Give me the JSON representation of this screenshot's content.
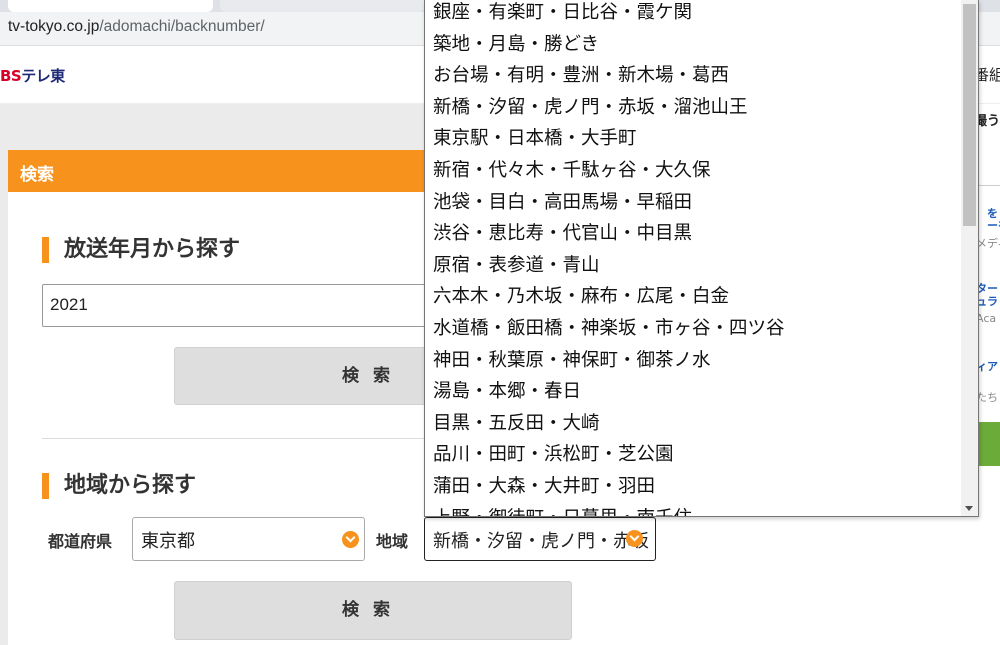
{
  "browser": {
    "url_host": "tv-tokyo.co.jp",
    "url_path": "/adomachi/backnumber/"
  },
  "header": {
    "logo_bs": "BS",
    "logo_tv": "テレ東"
  },
  "search": {
    "panel_title": "検索",
    "year_section_title": "放送年月から探す",
    "year_value": "2021",
    "year_button": "検索",
    "region_section_title": "地域から探す",
    "prefecture_label": "都道府県",
    "prefecture_value": "東京都",
    "area_label": "地域",
    "area_value": "新橋・汐留・虎ノ門・赤坂",
    "region_button": "検索"
  },
  "dropdown": {
    "options": [
      "銀座・有楽町・日比谷・霞ケ関",
      "築地・月島・勝どき",
      "お台場・有明・豊洲・新木場・葛西",
      "新橋・汐留・虎ノ門・赤坂・溜池山王",
      "東京駅・日本橋・大手町",
      "新宿・代々木・千駄ヶ谷・大久保",
      "池袋・目白・高田馬場・早稲田",
      "渋谷・恵比寿・代官山・中目黒",
      "原宿・表参道・青山",
      "六本木・乃木坂・麻布・広尾・白金",
      "水道橋・飯田橋・神楽坂・市ヶ谷・四ツ谷",
      "神田・秋葉原・神保町・御茶ノ水",
      "湯島・本郷・春日",
      "目黒・五反田・大崎",
      "品川・田町・浜松町・芝公園",
      "蒲田・大森・大井町・羽田",
      "上野・御徒町・日暮里・南千住"
    ]
  },
  "sidebar": {
    "frag1": "番組",
    "frag2": "撮う",
    "frag3": "を",
    "frag4": "ーを",
    "frag5": "メディ",
    "frag6": "ター",
    "frag7": "ュラ",
    "frag8": "Aca",
    "frag9": "ィア",
    "frag10": "たち"
  },
  "colors": {
    "accent": "#f7931d",
    "brand_red": "#d6002a",
    "brand_navy": "#1e2a78"
  }
}
